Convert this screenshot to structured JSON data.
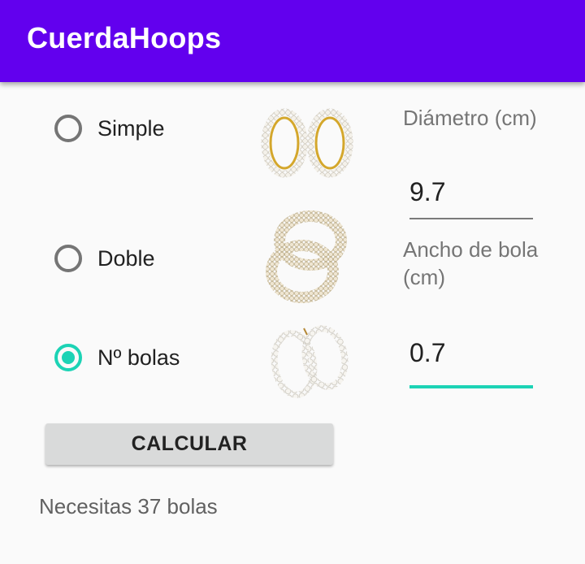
{
  "app": {
    "title": "CuerdaHoops",
    "accent_color": "#6200ee",
    "highlight_color": "#1cd3b5"
  },
  "options": [
    {
      "label": "Simple",
      "checked": false,
      "image": "pearl-hoop-earrings-icon"
    },
    {
      "label": "Doble",
      "checked": false,
      "image": "double-beaded-hoop-earrings-icon"
    },
    {
      "label": "Nº bolas",
      "checked": true,
      "image": "pearl-strand-hoop-earrings-icon"
    }
  ],
  "diametro": {
    "label": "Diámetro (cm)",
    "value": "9.7"
  },
  "ancho": {
    "label": "Ancho de bola (cm)",
    "value": "0.7"
  },
  "calcular_button": {
    "label": "CALCULAR"
  },
  "result": {
    "text": "Necesitas 37 bolas"
  }
}
